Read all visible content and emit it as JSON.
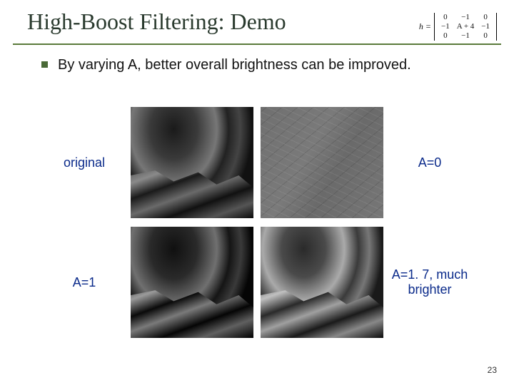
{
  "title": "High-Boost Filtering: Demo",
  "kernel": {
    "prefix": "h =",
    "rows": [
      [
        "0",
        "−1",
        "0"
      ],
      [
        "−1",
        "A + 4",
        "−1"
      ],
      [
        "0",
        "−1",
        "0"
      ]
    ]
  },
  "bullet": "By varying A, better overall brightness can be improved.",
  "labels": {
    "original": "original",
    "a0": "A=0",
    "a1": "A=1",
    "a17": "A=1. 7, much brighter"
  },
  "page_number": "23"
}
